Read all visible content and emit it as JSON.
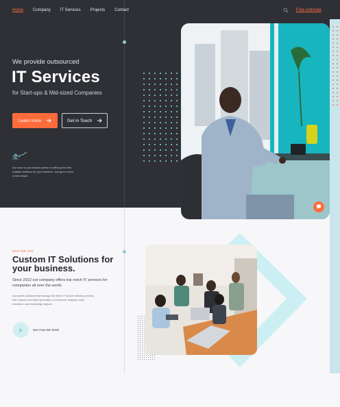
{
  "nav": {
    "items": [
      {
        "label": "Home",
        "active": true
      },
      {
        "label": "Company",
        "active": false
      },
      {
        "label": "IT Services",
        "active": false
      },
      {
        "label": "Projects",
        "active": false
      },
      {
        "label": "Contact",
        "active": false
      }
    ],
    "search_icon": "search-icon",
    "estimate_label": "Free estimate"
  },
  "hero": {
    "kicker": "We provide outsourced",
    "title": "IT Services",
    "subtitle": "for Start-ups & Mid-sized Companies",
    "primary_button": "Learn more",
    "secondary_button": "Get in Touch",
    "body": "Our team is your trusted partner in offering the best suitable solutions for your business. Just get in touch. Is that simple."
  },
  "section": {
    "eyebrow": "WHO WE ARE",
    "title": "Custom IT Solutions for your business.",
    "lead": "Since 2012 our company offers top notch IT services for companies all over the world.",
    "body": "It provides solutions that manage the entire IT service delivery process, from request and ticket generation, to research, analysis, issue resolution, and knowledge capture.",
    "video_label": "See How We Work"
  },
  "colors": {
    "accent": "#ff6c3c",
    "hero_bg": "#2e3036",
    "teal": "#8fdbe3"
  }
}
